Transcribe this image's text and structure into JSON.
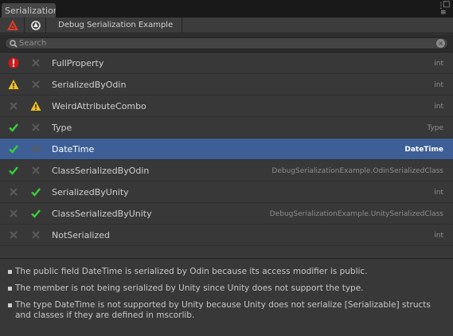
{
  "window": {
    "tab_title": "Serialization De",
    "toolbar_title": "Debug Serialization Example",
    "icons": [
      "odin-icon",
      "unity-icon",
      "window-menu-icon",
      "maximize-icon"
    ]
  },
  "search": {
    "placeholder": "Search",
    "value": ""
  },
  "colors": {
    "selection": "#3d5f96",
    "error": "#d01818",
    "warning": "#f2c01e",
    "check": "#38d038",
    "cross": "#5a5a5a"
  },
  "rows": [
    {
      "name": "FullProperty",
      "type": "int",
      "odin_state": "error-icon",
      "unity_state": "cross-icon",
      "selected": false
    },
    {
      "name": "SerializedByOdin",
      "type": "int",
      "odin_state": "warning-icon",
      "unity_state": "cross-icon",
      "selected": false
    },
    {
      "name": "WeirdAttributeCombo",
      "type": "int",
      "odin_state": "cross-icon",
      "unity_state": "warning-icon",
      "selected": false
    },
    {
      "name": "Type",
      "type": "Type",
      "odin_state": "check-icon",
      "unity_state": "cross-icon",
      "selected": false
    },
    {
      "name": "DateTime",
      "type": "DateTime",
      "odin_state": "check-icon",
      "unity_state": "cross-icon",
      "selected": true
    },
    {
      "name": "ClassSerializedByOdin",
      "type": "DebugSerializationExample.OdinSerializedClass",
      "odin_state": "check-icon",
      "unity_state": "cross-icon",
      "selected": false
    },
    {
      "name": "SerializedByUnity",
      "type": "int",
      "odin_state": "cross-icon",
      "unity_state": "check-icon",
      "selected": false
    },
    {
      "name": "ClassSerializedByUnity",
      "type": "DebugSerializationExample.UnitySerializedClass",
      "odin_state": "cross-icon",
      "unity_state": "check-icon",
      "selected": false
    },
    {
      "name": "NotSerialized",
      "type": "int",
      "odin_state": "cross-icon",
      "unity_state": "cross-icon",
      "selected": false
    }
  ],
  "notes": [
    "The public field DateTime is serialized by Odin because its access modifier is public.",
    "The member is not being serialized by Unity since Unity does not support the type.",
    "The type DateTime is not supported by Unity because Unity does not serialize [Serializable] structs and classes if they are defined in mscorlib."
  ]
}
